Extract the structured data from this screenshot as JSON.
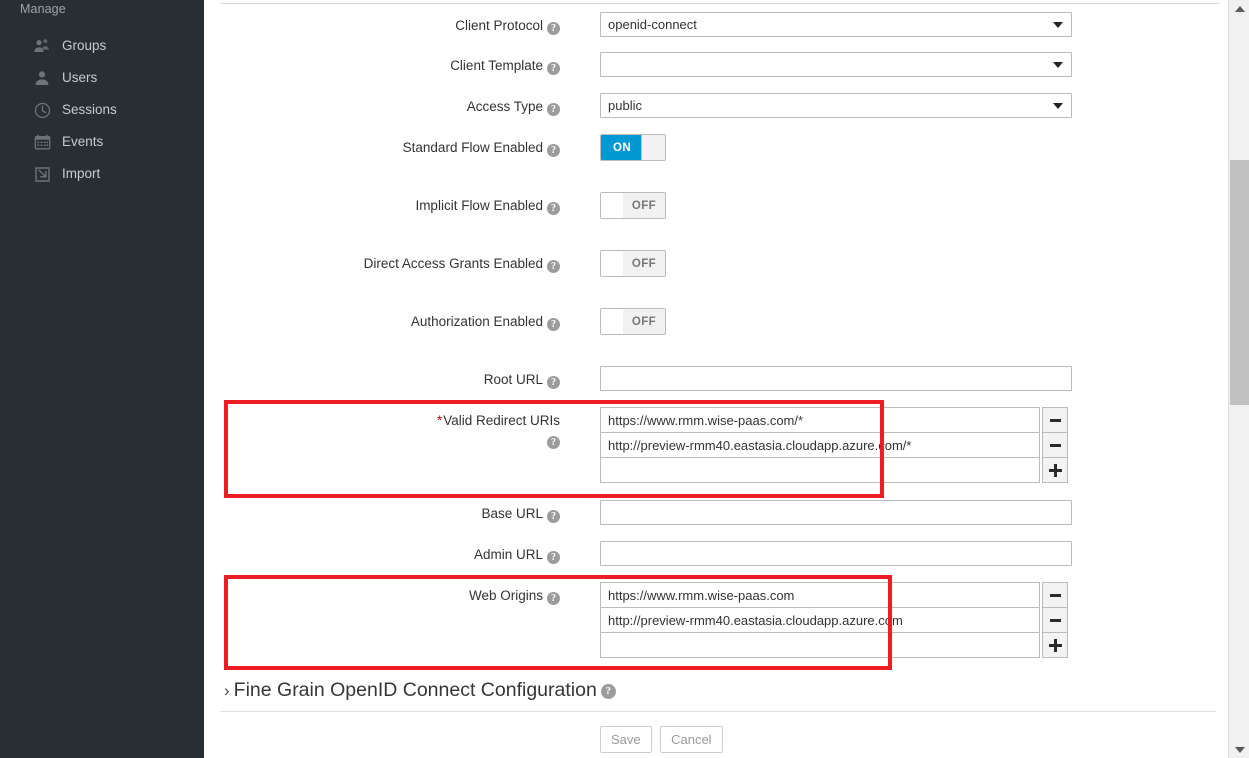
{
  "sidebar": {
    "heading": "Manage",
    "items": [
      {
        "label": "Groups",
        "icon": "groups-icon"
      },
      {
        "label": "Users",
        "icon": "user-icon"
      },
      {
        "label": "Sessions",
        "icon": "clock-icon"
      },
      {
        "label": "Events",
        "icon": "calendar-icon"
      },
      {
        "label": "Import",
        "icon": "import-icon"
      }
    ]
  },
  "form": {
    "client_protocol": {
      "label": "Client Protocol",
      "value": "openid-connect",
      "help": "?"
    },
    "client_template": {
      "label": "Client Template",
      "value": "",
      "help": "?"
    },
    "access_type": {
      "label": "Access Type",
      "value": "public",
      "help": "?"
    },
    "standard_flow": {
      "label": "Standard Flow Enabled",
      "state": "ON",
      "help": "?"
    },
    "implicit_flow": {
      "label": "Implicit Flow Enabled",
      "state": "OFF",
      "help": "?"
    },
    "direct_access_grants": {
      "label": "Direct Access Grants Enabled",
      "state": "OFF",
      "help": "?"
    },
    "authorization_enabled": {
      "label": "Authorization Enabled",
      "state": "OFF",
      "help": "?"
    },
    "root_url": {
      "label": "Root URL",
      "value": "",
      "help": "?"
    },
    "valid_redirect_uris": {
      "label": "Valid Redirect URIs",
      "required_marker": "*",
      "help": "?",
      "values": [
        "https://www.rmm.wise-paas.com/*",
        "http://preview-rmm40.eastasia.cloudapp.azure.com/*",
        ""
      ],
      "remove_glyph": "minus-icon",
      "add_glyph": "plus-icon",
      "highlighted": true
    },
    "base_url": {
      "label": "Base URL",
      "value": "",
      "help": "?"
    },
    "admin_url": {
      "label": "Admin URL",
      "value": "",
      "help": "?"
    },
    "web_origins": {
      "label": "Web Origins",
      "help": "?",
      "values": [
        "https://www.rmm.wise-paas.com",
        "http://preview-rmm40.eastasia.cloudapp.azure.com",
        ""
      ],
      "remove_glyph": "minus-icon",
      "add_glyph": "plus-icon",
      "highlighted": true
    },
    "fine_grain_section": {
      "chevron": "›",
      "title": "Fine Grain OpenID Connect Configuration",
      "help": "?"
    },
    "save_button": "Save",
    "cancel_button": "Cancel"
  },
  "colors": {
    "sidebar_bg": "#292e34",
    "toggle_on": "#0099d3",
    "highlight_red": "#ee1c25",
    "required_red": "#cc0000"
  }
}
